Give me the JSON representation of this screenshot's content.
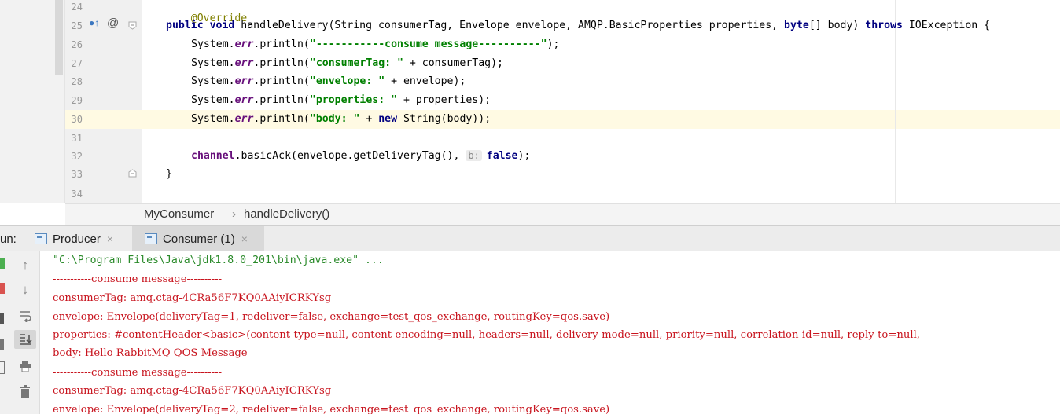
{
  "editor": {
    "line_numbers": [
      "24",
      "25",
      "26",
      "27",
      "28",
      "29",
      "30",
      "31",
      "32",
      "33",
      "34"
    ],
    "lines": {
      "l24": {
        "annotation": "@Override"
      },
      "l25": {
        "kw_public": "public",
        "kw_void": "void",
        "text1": " handleDelivery(String consumerTag, Envelope envelope, AMQP.BasicProperties properties, ",
        "kw_byte": "byte",
        "text2": "[] body) ",
        "kw_throws": "throws",
        "text3": " IOException {"
      },
      "l26": {
        "pre": "System.",
        "field": "err",
        "mid": ".println(",
        "str": "\"-----------consume message----------\"",
        "post": ");"
      },
      "l27": {
        "pre": "System.",
        "field": "err",
        "mid": ".println(",
        "str": "\"consumerTag: \"",
        "post": " + consumerTag);"
      },
      "l28": {
        "pre": "System.",
        "field": "err",
        "mid": ".println(",
        "str": "\"envelope: \"",
        "post": " + envelope);"
      },
      "l29": {
        "pre": "System.",
        "field": "err",
        "mid": ".println(",
        "str": "\"properties: \"",
        "post": " + properties);"
      },
      "l30": {
        "pre": "System.",
        "field": "err",
        "mid": ".println(",
        "str": "\"body: \"",
        "plus": " + ",
        "kw_new": "new",
        "post": " String(body));"
      },
      "l32": {
        "field": "channel",
        "mid": ".basicAck(envelope.getDeliveryTag(), ",
        "hint": "b:",
        "kw_false": "false",
        "post": ");"
      },
      "l33": {
        "brace": "}"
      }
    },
    "gutter_icons": {
      "implements": "●↑",
      "at": "@"
    }
  },
  "breadcrumb": {
    "class_name": "MyConsumer",
    "separator": "›",
    "method_name": "handleDelivery()"
  },
  "run": {
    "label": "un:",
    "tabs": [
      {
        "label": "Producer",
        "close": "×"
      },
      {
        "label": "Consumer (1)",
        "close": "×"
      }
    ]
  },
  "console": {
    "lines": [
      "\"C:\\Program Files\\Java\\jdk1.8.0_201\\bin\\java.exe\" ...",
      "-----------consume message----------",
      "consumerTag: amq.ctag-4CRa56F7KQ0AAiyICRKYsg",
      "envelope: Envelope(deliveryTag=1, redeliver=false, exchange=test_qos_exchange, routingKey=qos.save)",
      "properties: #contentHeader<basic>(content-type=null, content-encoding=null, headers=null, delivery-mode=null, priority=null, correlation-id=null, reply-to=null,",
      "body: Hello RabbitMQ QOS Message",
      "-----------consume message----------",
      "consumerTag: amq.ctag-4CRa56F7KQ0AAiyICRKYsg",
      "envelope: Envelope(deliveryTag=2, redeliver=false, exchange=test_qos_exchange, routingKey=qos.save)"
    ]
  },
  "toolbar_icons": [
    "up-arrow-icon",
    "down-arrow-icon",
    "soft-wrap-icon",
    "scroll-to-end-icon",
    "print-icon",
    "trash-icon"
  ],
  "colors": {
    "keyword": "#000080",
    "string": "#008000",
    "field": "#660e7a",
    "annotation": "#808000",
    "console_text": "#c8141e",
    "current_line": "#fffae3"
  }
}
